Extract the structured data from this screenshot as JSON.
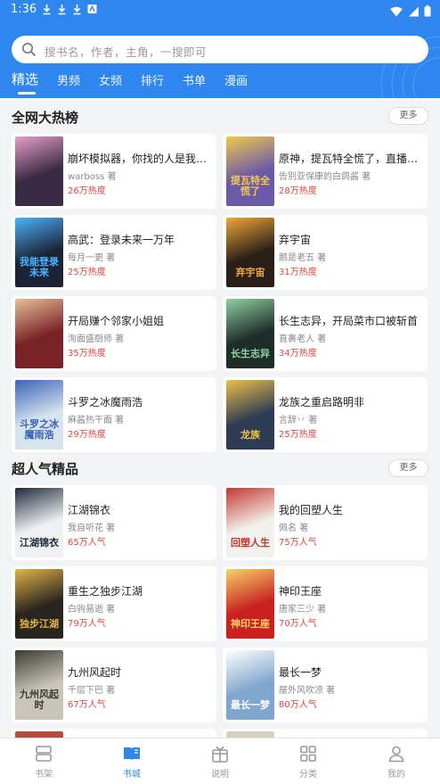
{
  "status": {
    "time": "1:36"
  },
  "search": {
    "placeholder": "搜书名，作者，主角，一搜即可"
  },
  "tabs": [
    {
      "label": "精选"
    },
    {
      "label": "男频"
    },
    {
      "label": "女频"
    },
    {
      "label": "排行"
    },
    {
      "label": "书单"
    },
    {
      "label": "漫画"
    }
  ],
  "sections": [
    {
      "title": "全网大热榜",
      "more": "更多",
      "books": [
        {
          "title": "崩坏模拟器，你找的人是我么?",
          "author": "warboss 著",
          "stat": "26万热度",
          "cover_color": "#3b2a45",
          "cover_accent": "#e7a0c8",
          "cover_text": ""
        },
        {
          "title": "原神，提瓦特全慌了，直播问…",
          "author": "告别亚保康的白鸽酱 著",
          "stat": "28万热度",
          "cover_color": "#6b5aa8",
          "cover_accent": "#f2c94c",
          "cover_text": "提瓦特全慌了"
        },
        {
          "title": "高武：登录未来一万年",
          "author": "每月一更 著",
          "stat": "25万热度",
          "cover_color": "#1b2335",
          "cover_accent": "#49b4ff",
          "cover_text": "我能登录未来"
        },
        {
          "title": "弃宇宙",
          "author": "鹅是老五 著",
          "stat": "31万热度",
          "cover_color": "#2a1e18",
          "cover_accent": "#f0a838",
          "cover_text": "弃宇宙"
        },
        {
          "title": "开局赚个邻家小姐姐",
          "author": "洵面盛厨师 著",
          "stat": "35万热度",
          "cover_color": "#7a2326",
          "cover_accent": "#e8c098",
          "cover_text": ""
        },
        {
          "title": "长生志异，开局菜市口被斩首",
          "author": "直裹老人 著",
          "stat": "34万热度",
          "cover_color": "#1e2c2a",
          "cover_accent": "#8fd1a0",
          "cover_text": "长生志异"
        },
        {
          "title": "斗罗之冰魔雨浩",
          "author": "麻酱热干面 著",
          "stat": "29万热度",
          "cover_color": "#d6e4ee",
          "cover_accent": "#3a62b8",
          "cover_text": "斗罗之冰魔雨浩"
        },
        {
          "title": "龙族之重启路明非",
          "author": "言辞丷 著",
          "stat": "25万热度",
          "cover_color": "#2d3c52",
          "cover_accent": "#f0c048",
          "cover_text": "龙族"
        }
      ]
    },
    {
      "title": "超人气精品",
      "more": "更多",
      "books": [
        {
          "title": "江湖锦衣",
          "author": "我自听花 著",
          "stat": "65万人气",
          "cover_color": "#eef0f2",
          "cover_accent": "#1f2a3a",
          "cover_text": "江湖锦衣"
        },
        {
          "title": "我的回塑人生",
          "author": "佩名 著",
          "stat": "75万人气",
          "cover_color": "#f3f1ec",
          "cover_accent": "#c4362f",
          "cover_text": "回塑人生"
        },
        {
          "title": "重生之独步江湖",
          "author": "白驹易逝 著",
          "stat": "79万人气",
          "cover_color": "#2a241e",
          "cover_accent": "#e2b44a",
          "cover_text": "独步江湖"
        },
        {
          "title": "神印王座",
          "author": "唐家三少 著",
          "stat": "70万人气",
          "cover_color": "#c8211f",
          "cover_accent": "#f6d46a",
          "cover_text": "神印王座"
        },
        {
          "title": "九州风起时",
          "author": "千层下巴 著",
          "stat": "67万人气",
          "cover_color": "#c9c5b8",
          "cover_accent": "#3a3a34",
          "cover_text": "九州风起时"
        },
        {
          "title": "最长一梦",
          "author": "屋外风吹凉 著",
          "stat": "80万人气",
          "cover_color": "#7fa6cc",
          "cover_accent": "#ffffff",
          "cover_text": "最长一梦"
        }
      ]
    }
  ],
  "bottom_nav": [
    {
      "label": "书架",
      "icon": "bookshelf-icon",
      "active": false
    },
    {
      "label": "书城",
      "icon": "book-open-icon",
      "active": true
    },
    {
      "label": "说明",
      "icon": "gift-icon",
      "active": false
    },
    {
      "label": "分类",
      "icon": "grid-icon",
      "active": false
    },
    {
      "label": "我的",
      "icon": "user-icon",
      "active": false
    }
  ],
  "colors": {
    "primary": "#2f86ef",
    "heat": "#e8413a",
    "background": "#f2f3f5"
  }
}
